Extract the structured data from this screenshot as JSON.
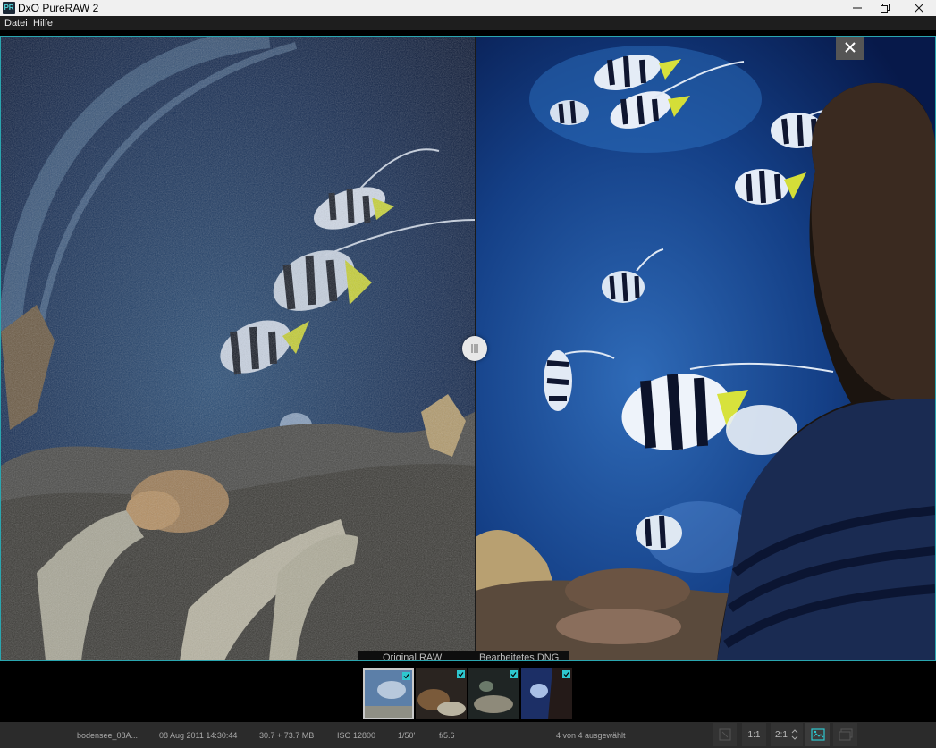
{
  "window": {
    "app_icon_text": "PR",
    "title": "DxO PureRAW 2",
    "icons": {
      "minimize": "minimize-icon",
      "restore": "restore-icon",
      "close": "close-icon"
    }
  },
  "menu": {
    "items": [
      {
        "label": "Datei"
      },
      {
        "label": "Hilfe"
      }
    ]
  },
  "viewer": {
    "left_label": "Original RAW",
    "right_label": "Bearbeitetes DNG",
    "close_icon": "close-icon",
    "split_handle_icon": "split-grip-icon",
    "accent": "#2aa6b0"
  },
  "filmstrip": {
    "thumbnails": [
      {
        "name": "thumb-1",
        "selected": true,
        "checked": true
      },
      {
        "name": "thumb-2",
        "selected": false,
        "checked": true
      },
      {
        "name": "thumb-3",
        "selected": false,
        "checked": true
      },
      {
        "name": "thumb-4",
        "selected": false,
        "checked": true
      }
    ],
    "check_color": "#2ec7cf"
  },
  "status": {
    "filename": "bodensee_08A...",
    "date": "08 Aug 2011 14:30:44",
    "size": "30.7 + 73.7 MB",
    "iso": "ISO 12800",
    "shutter": "1/50'",
    "aperture": "f/5.6",
    "selection": "4 von 4 ausgewählt",
    "zoom_1_1": "1:1",
    "zoom_2_1": "2:1"
  }
}
